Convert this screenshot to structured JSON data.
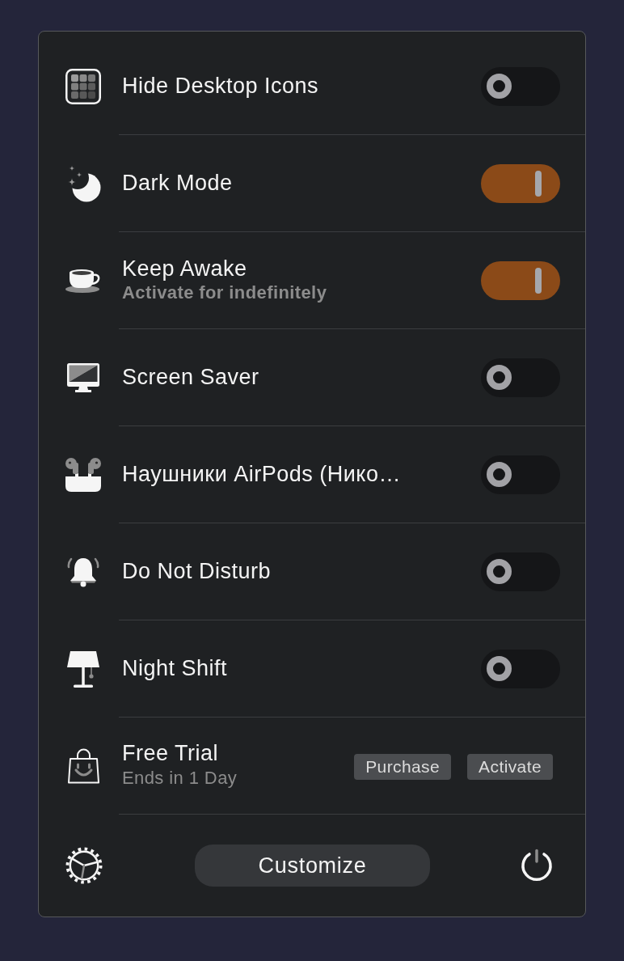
{
  "items": [
    {
      "label": "Hide Desktop Icons",
      "on": false
    },
    {
      "label": "Dark Mode",
      "on": true
    },
    {
      "label": "Keep Awake",
      "subtitle": "Activate for indefinitely",
      "on": true
    },
    {
      "label": "Screen Saver",
      "on": false
    },
    {
      "label": "Наушники AirPods (Нико…",
      "on": false
    },
    {
      "label": "Do Not Disturb",
      "on": false
    },
    {
      "label": "Night Shift",
      "on": false
    }
  ],
  "trial": {
    "label": "Free Trial",
    "subtitle": "Ends in 1 Day",
    "buttons": [
      "Purchase",
      "Activate"
    ]
  },
  "footer": {
    "button": "Customize"
  }
}
